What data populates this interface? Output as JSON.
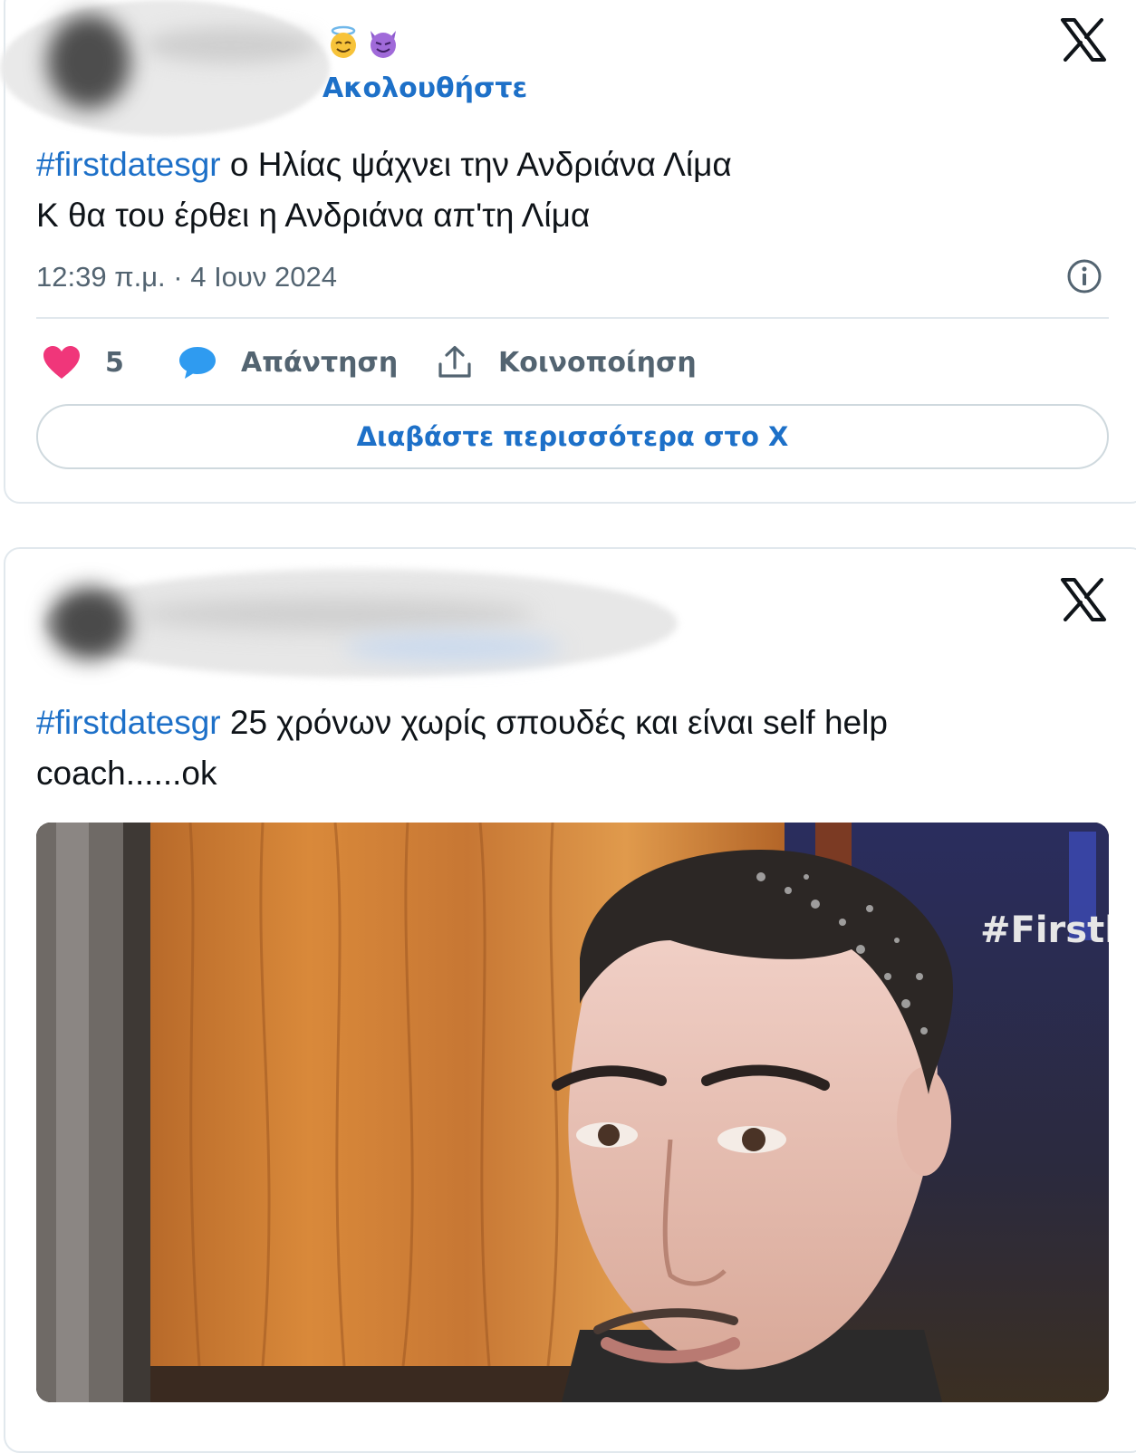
{
  "tweet1": {
    "follow_label": "Ακολουθήστε",
    "hashtag": "#firstdatesgr",
    "text_line1": " ο Ηλίας ψάχνει την Ανδριάνα Λίμα",
    "text_line2": "Κ θα του έρθει η Ανδριάνα απ'τη Λίμα",
    "timestamp": "12:39 π.μ. · 4 Ιουν 2024",
    "like_count": "5",
    "reply_label": "Απάντηση",
    "share_label": "Κοινοποίηση",
    "read_more_label": "Διαβάστε περισσότερα στο X"
  },
  "tweet2": {
    "hashtag": "#firstdatesgr",
    "text_line1": " 25 χρόνων χωρίς σπουδές και είναι self help",
    "text_line2": "coach......ok",
    "photo_overlay_text": "#Firstl"
  },
  "colors": {
    "link_blue": "#1d70c8",
    "like_pink": "#f0367a",
    "reply_blue": "#2f9bf0",
    "muted_gray": "#536471"
  }
}
